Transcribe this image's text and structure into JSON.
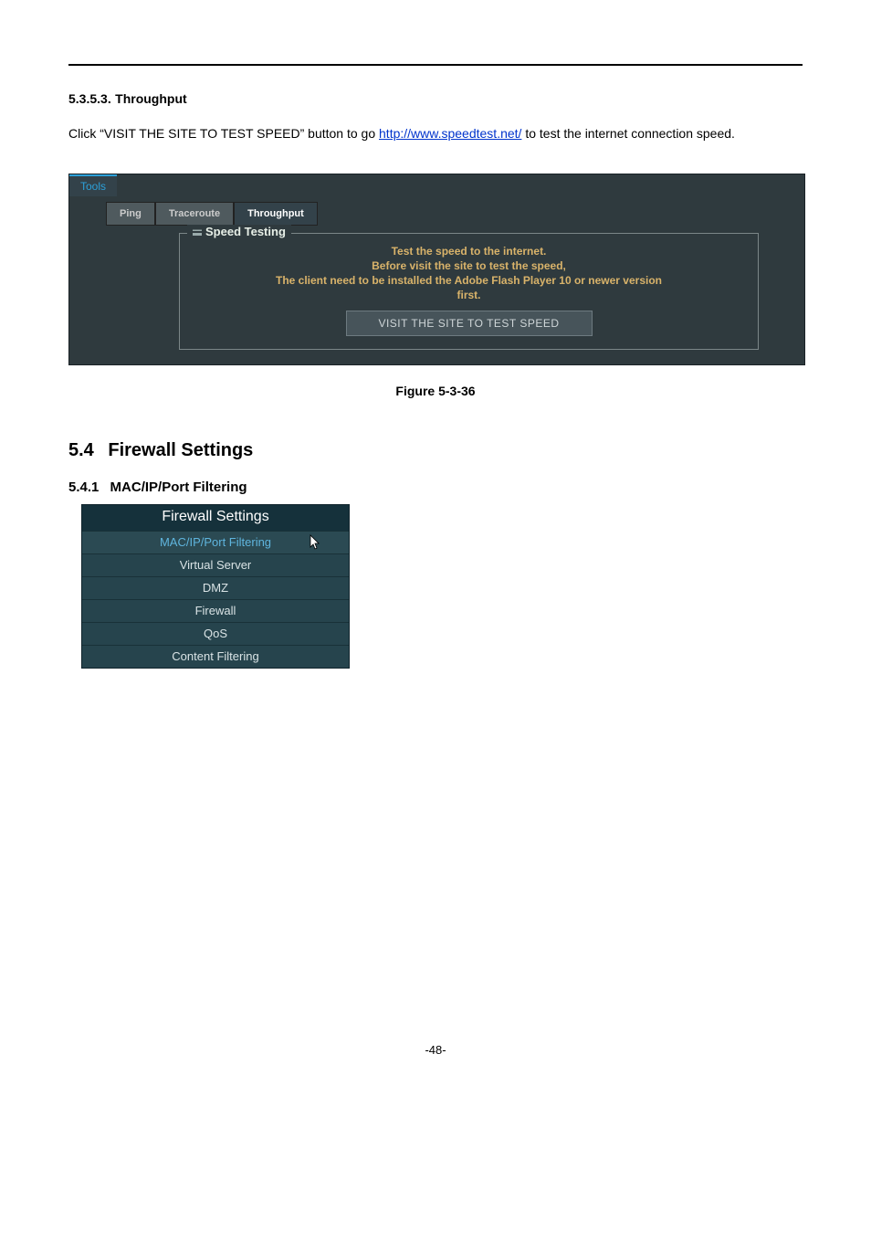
{
  "section_5353": {
    "number": "5.3.5.3.",
    "title": "Throughput",
    "body_prefix": "Click “VISIT THE SITE TO TEST SPEED” button to go ",
    "link_text": "http://www.speedtest.net/",
    "body_suffix": " to test the internet connection speed."
  },
  "tools_panel": {
    "tab_label": "Tools",
    "tabs": {
      "ping": "Ping",
      "traceroute": "Traceroute",
      "throughput": "Throughput"
    },
    "legend": "Speed Testing",
    "lines": {
      "l1": "Test the speed to the internet.",
      "l2": "Before visit the site to test the speed,",
      "l3": "The client need to be installed the Adobe Flash Player 10 or newer version",
      "l4": "first."
    },
    "button": "VISIT THE SITE TO TEST SPEED"
  },
  "figure_caption": "Figure 5-3-36",
  "section_54": {
    "number": "5.4",
    "title": "Firewall Settings"
  },
  "section_541": {
    "number": "5.4.1",
    "title": "MAC/IP/Port Filtering"
  },
  "fw_menu": {
    "header": "Firewall Settings",
    "items": {
      "i0": "MAC/IP/Port Filtering",
      "i1": "Virtual Server",
      "i2": "DMZ",
      "i3": "Firewall",
      "i4": "QoS",
      "i5": "Content Filtering"
    }
  },
  "footer": "-48-"
}
